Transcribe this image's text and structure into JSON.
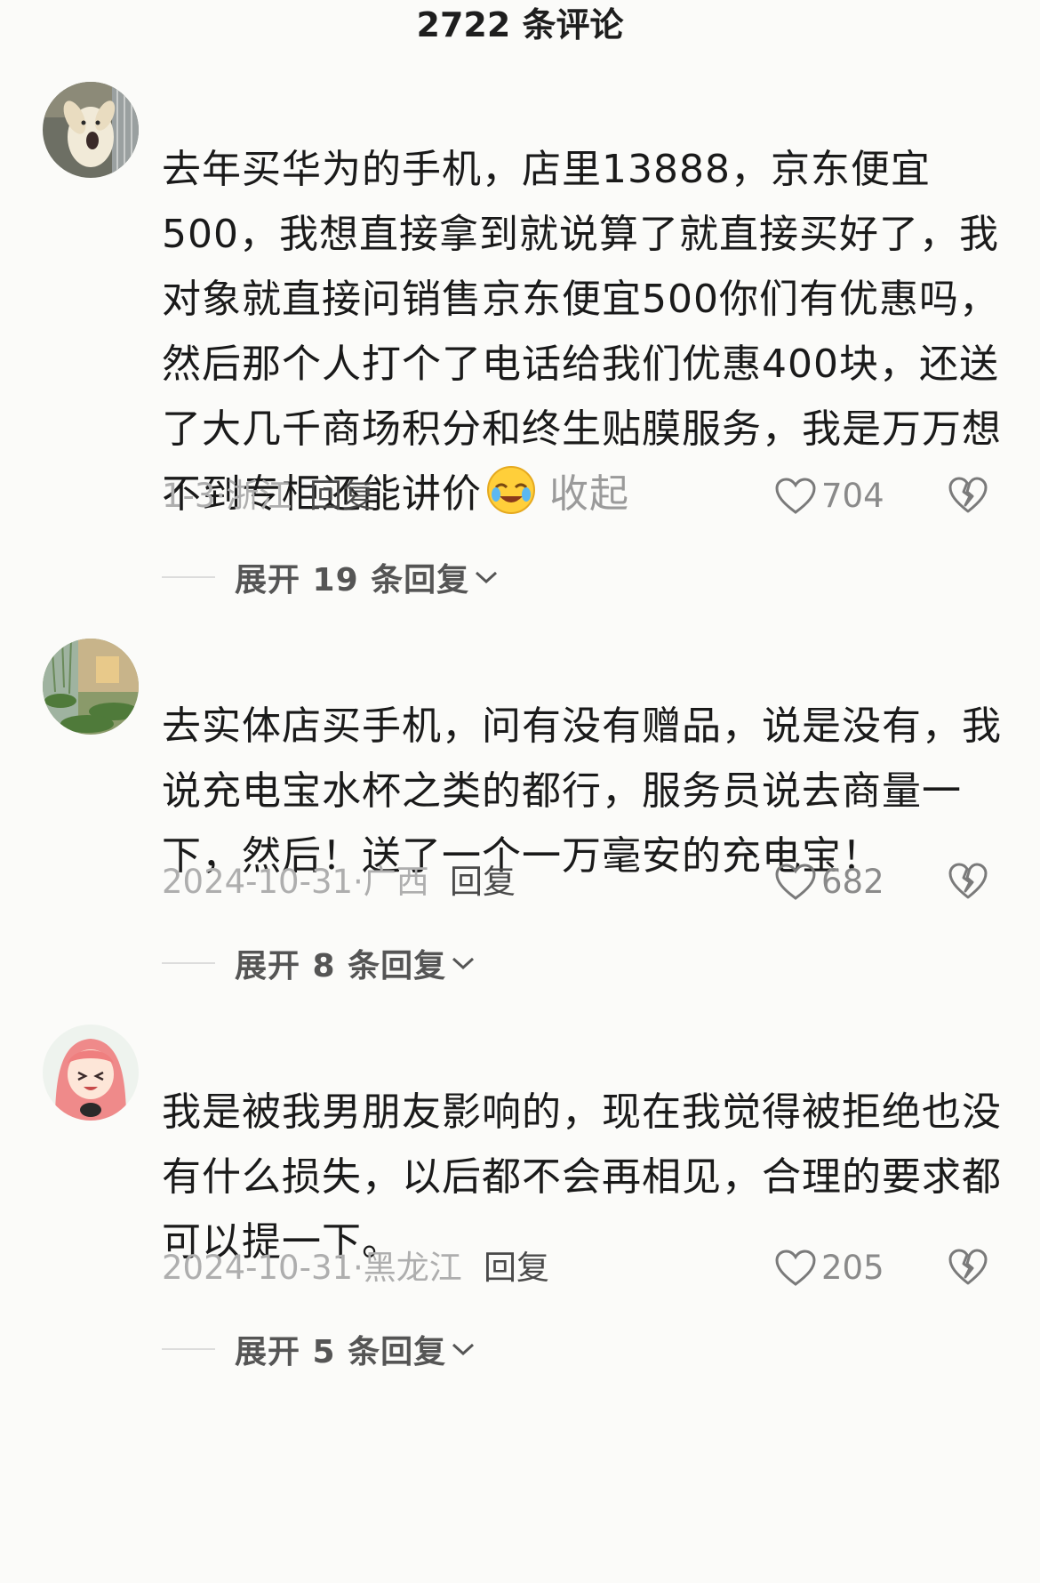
{
  "header": {
    "title": "2722 条评论"
  },
  "comments": [
    {
      "username": "",
      "text": "去年买华为的手机，店里13888，京东便宜500，我想直接拿到就说算了就直接买好了，我对象就直接问销售京东便宜500你们有优惠吗，然后那个人打个了电话给我们优惠400块，还送了大几千商场积分和终生贴膜服务，我是万万想不到专柜还能讲价",
      "emoji": "crying-laughing-emoji",
      "collapse_label": "收起",
      "date": "1-3",
      "separator": "·",
      "region": "浙江",
      "reply_label": "回复",
      "likes": "704",
      "expand_label": "展开 19 条回复"
    },
    {
      "username": "",
      "text": "去实体店买手机，问有没有赠品，说是没有，我说充电宝水杯之类的都行，服务员说去商量一下，然后！送了一个一万毫安的充电宝！",
      "date": "2024-10-31",
      "separator": "·",
      "region": "广西",
      "reply_label": "回复",
      "likes": "682",
      "expand_label": "展开 8 条回复"
    },
    {
      "username": "",
      "text": "我是被我男朋友影响的，现在我觉得被拒绝也没有什么损失，以后都不会再相见，合理的要求都可以提一下。",
      "date": "2024-10-31",
      "separator": "·",
      "region": "黑龙江",
      "reply_label": "回复",
      "likes": "205",
      "expand_label": "展开 5 条回复"
    }
  ],
  "icons": {
    "like": "heart-outline-icon",
    "dislike": "broken-heart-icon",
    "expand": "chevron-down-icon"
  },
  "colors": {
    "background": "#fbfbf9",
    "meta_text": "#aeaeae",
    "reply_text": "#4a4a4a"
  }
}
